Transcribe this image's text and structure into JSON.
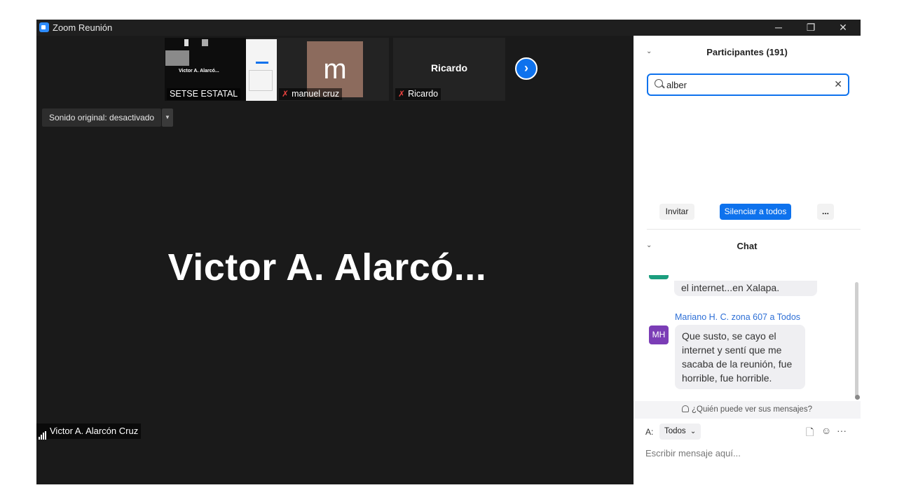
{
  "window": {
    "title": "Zoom Reunión",
    "controls": {
      "minimize": "─",
      "restore": "❐",
      "close": "✕"
    }
  },
  "video": {
    "thumbnails": [
      {
        "name": "SETSE ESTATAL",
        "muted": false,
        "screen_text": "Victor A. Alarcó..."
      },
      {
        "name": "manuel cruz",
        "muted": true,
        "avatar_letter": "m"
      },
      {
        "name": "Ricardo",
        "muted": true,
        "display_name": "Ricardo"
      }
    ],
    "next_arrow": "›",
    "original_sound": "Sonido original: desactivado",
    "original_sound_dropdown": "▼",
    "active_speaker_big": "Victor A. Alarcó...",
    "active_speaker_tag": "Victor A. Alarcón Cruz",
    "mic_icon": "🎙"
  },
  "participants": {
    "title": "Participantes (191)",
    "collapse_icon": "⌄",
    "search_value": "alber",
    "clear_icon": "✕",
    "buttons": {
      "invite": "Invitar",
      "mute_all": "Silenciar a todos",
      "more": "..."
    }
  },
  "chat": {
    "title": "Chat",
    "collapse_icon": "⌄",
    "messages": [
      {
        "text": "el internet...en Xalapa."
      },
      {
        "sender": "Mariano H. C. zona 607 a Todos",
        "initials": "MH",
        "lines": [
          "Que susto, se cayo el",
          "internet y sentí que me",
          "sacaba de la reunión, fue",
          "horrible, fue horrible."
        ]
      }
    ],
    "who_can_see": "¿Quién puede ver sus mensajes?",
    "to_label": "A:",
    "to_value": "Todos",
    "to_chevron": "⌄",
    "tools": {
      "file": "🗋",
      "emoji": "☺",
      "more": "···"
    },
    "compose_placeholder": "Escribir mensaje aquí..."
  },
  "colors": {
    "accent": "#0e72ed",
    "avatar_mh": "#7b3db6",
    "mute_red": "#e8423e"
  }
}
